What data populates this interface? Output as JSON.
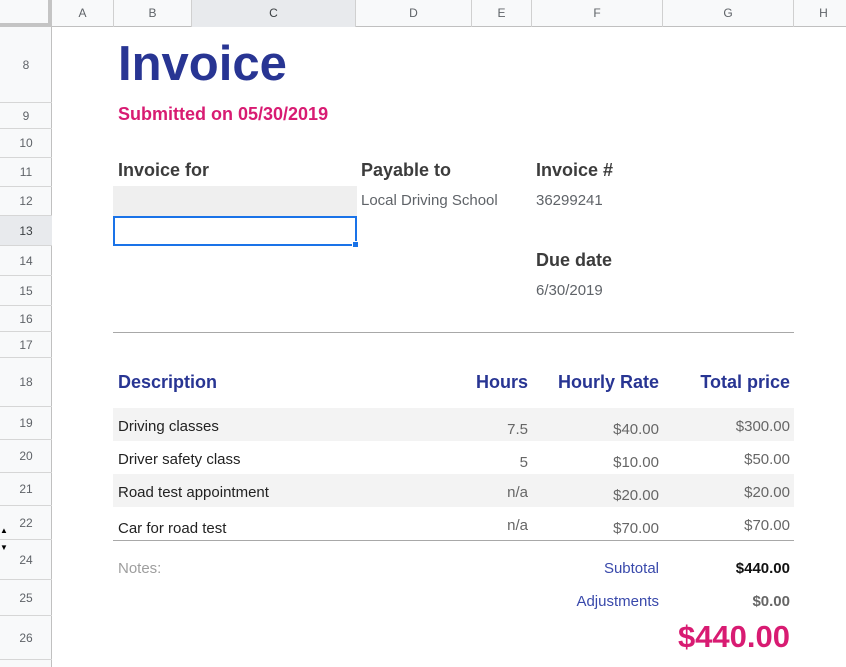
{
  "columns": [
    "A",
    "B",
    "C",
    "D",
    "E",
    "F",
    "G",
    "H"
  ],
  "rows": [
    "8",
    "9",
    "10",
    "11",
    "12",
    "13",
    "14",
    "15",
    "16",
    "17",
    "18",
    "19",
    "20",
    "21",
    "22",
    "24",
    "25",
    "26"
  ],
  "invoice": {
    "title": "Invoice",
    "submitted": "Submitted on 05/30/2019",
    "invoice_for_label": "Invoice for",
    "payable_to_label": "Payable to",
    "payable_to_value": "Local Driving School",
    "invoice_num_label": "Invoice #",
    "invoice_num_value": "36299241",
    "due_date_label": "Due date",
    "due_date_value": "6/30/2019"
  },
  "table": {
    "headers": {
      "description": "Description",
      "hours": "Hours",
      "rate": "Hourly Rate",
      "total": "Total price"
    },
    "items": [
      {
        "description": "Driving classes",
        "hours": "7.5",
        "rate": "$40.00",
        "total": "$300.00"
      },
      {
        "description": "Driver safety class",
        "hours": "5",
        "rate": "$10.00",
        "total": "$50.00"
      },
      {
        "description": "Road test appointment",
        "hours": "n/a",
        "rate": "$20.00",
        "total": "$20.00"
      },
      {
        "description": "Car for road test",
        "hours": "n/a",
        "rate": "$70.00",
        "total": "$70.00"
      }
    ]
  },
  "summary": {
    "notes_label": "Notes:",
    "subtotal_label": "Subtotal",
    "subtotal_value": "$440.00",
    "adjustments_label": "Adjustments",
    "adjustments_value": "$0.00",
    "grand_total": "$440.00"
  },
  "colors": {
    "title": "#283593",
    "accent": "#d81b72",
    "selection": "#1a73e8"
  }
}
